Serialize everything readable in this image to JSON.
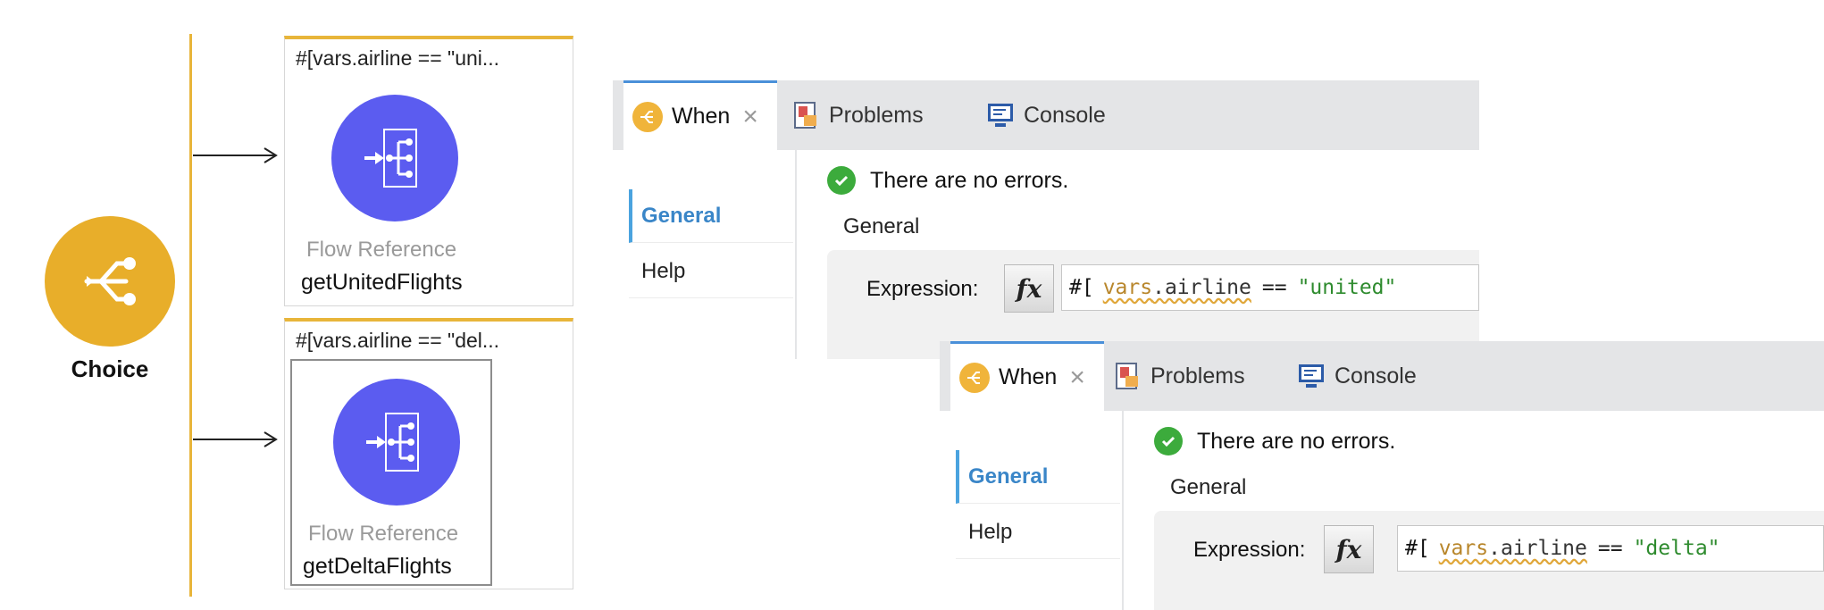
{
  "flow": {
    "choice_label": "Choice",
    "routes": [
      {
        "expression": "#[vars.airline == \"uni...",
        "component_type": "Flow Reference",
        "component_name": "getUnitedFlights"
      },
      {
        "expression": "#[vars.airline == \"del...",
        "component_type": "Flow Reference",
        "component_name": "getDeltaFlights"
      }
    ]
  },
  "panels": [
    {
      "tabs": {
        "when": "When",
        "problems": "Problems",
        "console": "Console"
      },
      "side_tabs": [
        "General",
        "Help"
      ],
      "status_text": "There are no errors.",
      "section_title": "General",
      "expression_label": "Expression:",
      "fx_label": "fx",
      "expression": {
        "open": "#[",
        "vars": "vars",
        "dot_prop": ".airline",
        "operator": "==",
        "value": "\"united\""
      }
    },
    {
      "tabs": {
        "when": "When",
        "problems": "Problems",
        "console": "Console"
      },
      "side_tabs": [
        "General",
        "Help"
      ],
      "status_text": "There are no errors.",
      "section_title": "General",
      "expression_label": "Expression:",
      "fx_label": "fx",
      "expression": {
        "open": "#[",
        "vars": "vars",
        "dot_prop": ".airline",
        "operator": "==",
        "value": "\"delta\""
      }
    }
  ],
  "colors": {
    "choice": "#e8ae2a",
    "flow_reference": "#5b5cf0",
    "route_accent": "#e8b53a",
    "active_side_tab": "#3a86c8",
    "string_literal": "#2e8b2e",
    "success": "#3cab3c"
  },
  "icons": {
    "choice": "choice-router-icon",
    "flow_reference": "flow-reference-icon",
    "when_tab": "when-icon",
    "problems_tab": "problems-icon",
    "console_tab": "console-icon",
    "status": "check-circle-icon"
  }
}
